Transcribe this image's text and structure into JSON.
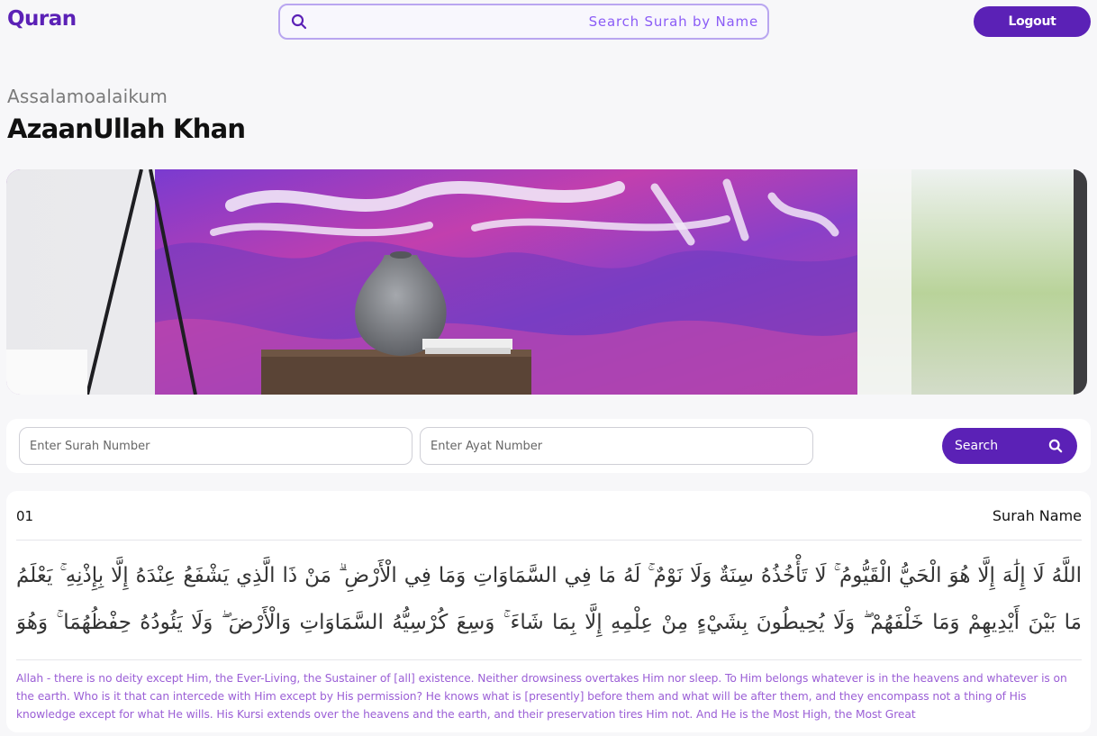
{
  "app": {
    "logo": "Quran"
  },
  "header": {
    "search_placeholder": "Search Surah by Name",
    "logout_label": "Logout"
  },
  "user": {
    "greeting": "Assalamoalaikum",
    "name": "AzaanUllah Khan"
  },
  "search_panel": {
    "surah_placeholder": "Enter Surah Number",
    "ayat_placeholder": "Enter Ayat Number",
    "search_label": "Search"
  },
  "ayat_card": {
    "number": "01",
    "surah_name": "Surah Name",
    "arabic": "اللَّهُ لَا إِلَٰهَ إِلَّا هُوَ الْحَيُّ الْقَيُّومُ ۚ لَا تَأْخُذُهُ سِنَةٌ وَلَا نَوْمٌ ۚ لَهُ مَا فِي السَّمَاوَاتِ وَمَا فِي الْأَرْضِ ۗ مَنْ ذَا الَّذِي يَشْفَعُ عِنْدَهُ إِلَّا بِإِذْنِهِ ۚ يَعْلَمُ مَا بَيْنَ أَيْدِيهِمْ وَمَا خَلْفَهُمْ ۖ وَلَا يُحِيطُونَ بِشَيْءٍ مِنْ عِلْمِهِ إِلَّا بِمَا شَاءَ ۚ وَسِعَ كُرْسِيُّهُ السَّمَاوَاتِ وَالْأَرْضَ ۖ وَلَا يَئُودُهُ حِفْظُهُمَا ۚ وَهُوَ الْعَلِيُّ الْعَظِيمُ",
    "translation": "Allah - there is no deity except Him, the Ever-Living, the Sustainer of [all] existence. Neither drowsiness overtakes Him nor sleep. To Him belongs whatever is in the heavens and whatever is on the earth. Who is it that can intercede with Him except by His permission? He knows what is [presently] before them and what will be after them, and they encompass not a thing of His knowledge except for what He wills. His Kursi extends over the heavens and the earth, and their preservation tires Him not. And He is the Most High, the Most Great"
  },
  "colors": {
    "brand": "#5b21b6",
    "translation_text": "#9b5fd6",
    "search_border": "#b9a6f0"
  },
  "icons": [
    "search-icon",
    "magnifier-icon"
  ]
}
